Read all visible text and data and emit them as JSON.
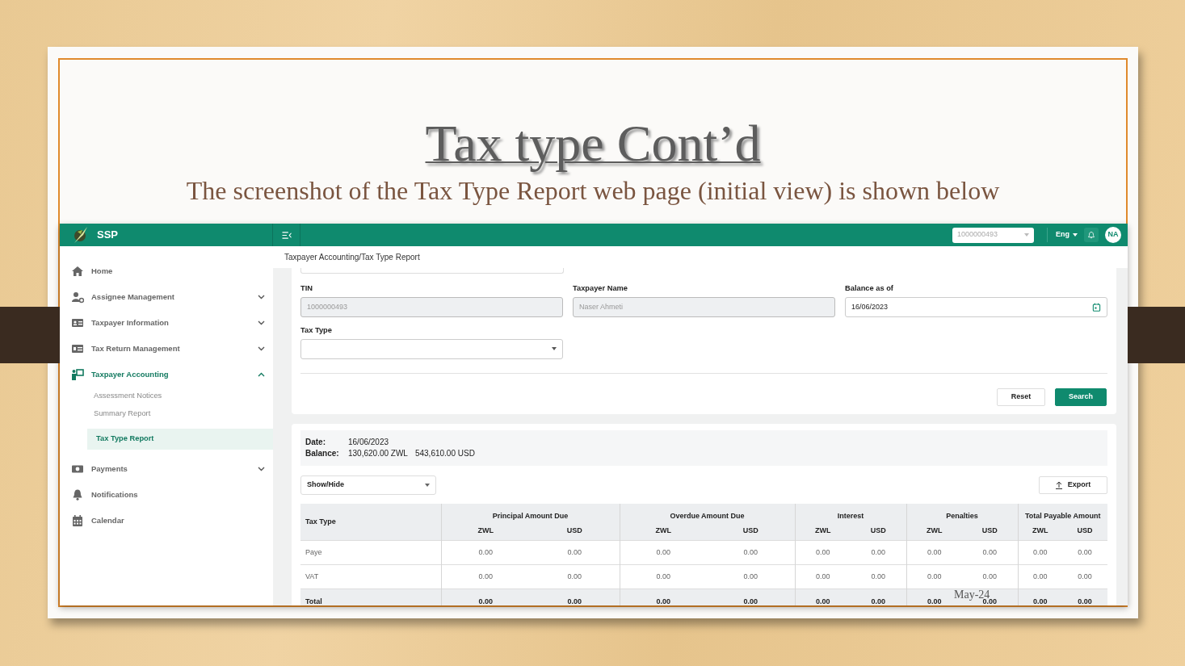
{
  "slide": {
    "title": "Tax type Cont’d",
    "subtitle": "The screenshot of the Tax Type Report web page (initial view) is shown below",
    "footer": "May-24"
  },
  "app": {
    "brand": "SSP",
    "tin_select": "1000000493",
    "language": "Eng",
    "avatar": "NA",
    "breadcrumb": "Taxpayer Accounting/Tax Type Report"
  },
  "sidebar": {
    "items": [
      {
        "label": "Home",
        "selected": false
      },
      {
        "label": "Assignee Management",
        "selected": false,
        "expanded": false
      },
      {
        "label": "Taxpayer Information",
        "selected": false,
        "expanded": false
      },
      {
        "label": "Tax Return Management",
        "selected": false,
        "expanded": false
      },
      {
        "label": "Taxpayer Accounting",
        "selected": true,
        "expanded": true,
        "children": [
          {
            "label": "Assessment Notices",
            "selected": false
          },
          {
            "label": "Summary Report",
            "selected": false
          },
          {
            "label": "Tax Type Report",
            "selected": true
          }
        ]
      },
      {
        "label": "Payments",
        "selected": false,
        "expanded": false
      },
      {
        "label": "Notifications",
        "selected": false
      },
      {
        "label": "Calendar",
        "selected": false
      }
    ]
  },
  "form": {
    "fields": [
      {
        "label": "TIN",
        "kind": "text",
        "value": "1000000493",
        "disabled": true
      },
      {
        "label": "Taxpayer Name",
        "kind": "text",
        "value": "Naser Ahmeti",
        "disabled": true
      },
      {
        "label": "Balance as of",
        "kind": "date",
        "value": "16/06/2023",
        "disabled": false
      },
      {
        "label": "Tax Type",
        "kind": "select",
        "disabled": false
      }
    ],
    "buttons": [
      {
        "label": "Reset",
        "kind": "secondary"
      },
      {
        "label": "Search",
        "kind": "primary"
      }
    ]
  },
  "summary": {
    "date_label": "Date:",
    "date": "16/06/2023",
    "balance_label": "Balance:",
    "balances": [
      "130,620.00 ZWL",
      "543,610.00 USD"
    ]
  },
  "show_hide": "Show/Hide",
  "export": "Export",
  "table": {
    "first_column": "Tax Type",
    "groups": [
      {
        "name": "Principal Amount Due",
        "subcolumns": [
          "ZWL",
          "USD"
        ]
      },
      {
        "name": "Overdue Amount Due",
        "subcolumns": [
          "ZWL",
          "USD"
        ]
      },
      {
        "name": "Interest",
        "subcolumns": [
          "ZWL",
          "USD"
        ]
      },
      {
        "name": "Penalties",
        "subcolumns": [
          "ZWL",
          "USD"
        ]
      },
      {
        "name": "Total Payable Amount",
        "subcolumns": [
          "ZWL",
          "USD"
        ]
      }
    ],
    "rows": [
      {
        "kind": "data",
        "label": "Paye",
        "values": [
          "0.00",
          "0.00",
          "0.00",
          "0.00",
          "0.00",
          "0.00",
          "0.00",
          "0.00",
          "0.00",
          "0.00"
        ]
      },
      {
        "kind": "data",
        "label": "VAT",
        "values": [
          "0.00",
          "0.00",
          "0.00",
          "0.00",
          "0.00",
          "0.00",
          "0.00",
          "0.00",
          "0.00",
          "0.00"
        ]
      },
      {
        "kind": "total",
        "label": "Total",
        "values": [
          "0.00",
          "0.00",
          "0.00",
          "0.00",
          "0.00",
          "0.00",
          "0.00",
          "0.00",
          "0.00",
          "0.00"
        ]
      }
    ]
  }
}
